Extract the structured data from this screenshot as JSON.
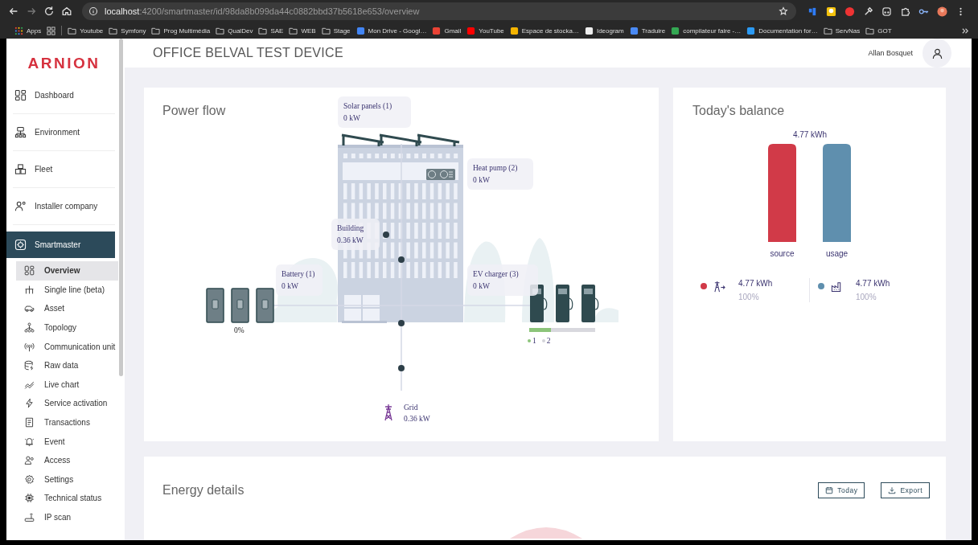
{
  "browser": {
    "url": {
      "host": "localhost",
      "path": ":4200/smartmaster/id/98da8b099da44c0882bbd37b5618e653/overview"
    },
    "bookmarks": [
      {
        "label": "Apps",
        "kind": "apps"
      },
      {
        "label": "Youtube",
        "kind": "folder"
      },
      {
        "label": "Symfony",
        "kind": "folder"
      },
      {
        "label": "Prog Multimédia",
        "kind": "folder"
      },
      {
        "label": "QualDev",
        "kind": "folder"
      },
      {
        "label": "SAE",
        "kind": "folder"
      },
      {
        "label": "WEB",
        "kind": "folder"
      },
      {
        "label": "Stage",
        "kind": "folder"
      },
      {
        "label": "Mon Drive - Googl…",
        "kind": "site"
      },
      {
        "label": "Gmail",
        "kind": "site"
      },
      {
        "label": "YouTube",
        "kind": "site"
      },
      {
        "label": "Espace de stocka…",
        "kind": "site"
      },
      {
        "label": "Ideogram",
        "kind": "site"
      },
      {
        "label": "Traduire",
        "kind": "site"
      },
      {
        "label": "compilateur faire -…",
        "kind": "site"
      },
      {
        "label": "Documentation for…",
        "kind": "site"
      },
      {
        "label": "ServNas",
        "kind": "folder"
      },
      {
        "label": "GOT",
        "kind": "folder"
      }
    ]
  },
  "sidebar": {
    "logo": "ARNION",
    "items": [
      {
        "label": "Dashboard",
        "selected": false
      },
      {
        "label": "Environment",
        "selected": false
      },
      {
        "label": "Fleet",
        "selected": false
      },
      {
        "label": "Installer company",
        "selected": false
      },
      {
        "label": "Smartmaster",
        "selected": true,
        "children": [
          {
            "label": "Overview",
            "selected": true
          },
          {
            "label": "Single line (beta)",
            "selected": false
          },
          {
            "label": "Asset",
            "selected": false
          },
          {
            "label": "Topology",
            "selected": false
          },
          {
            "label": "Communication unit",
            "selected": false
          },
          {
            "label": "Raw data",
            "selected": false
          },
          {
            "label": "Live chart",
            "selected": false
          },
          {
            "label": "Service activation",
            "selected": false
          },
          {
            "label": "Transactions",
            "selected": false
          },
          {
            "label": "Event",
            "selected": false
          },
          {
            "label": "Access",
            "selected": false
          },
          {
            "label": "Settings",
            "selected": false
          },
          {
            "label": "Technical status",
            "selected": false
          },
          {
            "label": "IP scan",
            "selected": false
          }
        ]
      }
    ]
  },
  "header": {
    "title": "OFFICE BELVAL TEST DEVICE",
    "user_name": "Allan Bosquet"
  },
  "power_flow": {
    "title": "Power flow",
    "nodes": [
      {
        "kind": "solar",
        "name": "Solar panels (1)",
        "value": "0 kW"
      },
      {
        "kind": "heat_pump",
        "name": "Heat pump (2)",
        "value": "0 kW"
      },
      {
        "kind": "building",
        "name": "Building",
        "value": "0.36 kW"
      },
      {
        "kind": "battery",
        "name": "Battery (1)",
        "value": "0 kW"
      },
      {
        "kind": "ev_charger",
        "name": "EV charger (3)",
        "value": "0 kW"
      },
      {
        "kind": "grid",
        "name": "Grid",
        "value": "0.36 kW"
      }
    ],
    "battery_charge": "0%",
    "ev_load": {
      "level": 0.33,
      "legend": [
        {
          "label": "1",
          "color": "#8cc47a"
        },
        {
          "label": "2",
          "color": "#d4d4da"
        }
      ]
    }
  },
  "balance": {
    "title": "Today's balance",
    "total": "4.77 kWh",
    "bars": [
      {
        "label": "source",
        "color": "#d13a48"
      },
      {
        "label": "usage",
        "color": "#5f8fae"
      }
    ],
    "summary": [
      {
        "kind": "source",
        "color": "#d13a48",
        "value": "4.77 kWh",
        "share": "100%"
      },
      {
        "kind": "usage",
        "color": "#5f8fae",
        "value": "4.77 kWh",
        "share": "100%"
      }
    ]
  },
  "energy_details": {
    "title": "Energy details",
    "buttons": [
      {
        "kind": "date",
        "label": "Today"
      },
      {
        "kind": "export",
        "label": "Export"
      }
    ]
  }
}
